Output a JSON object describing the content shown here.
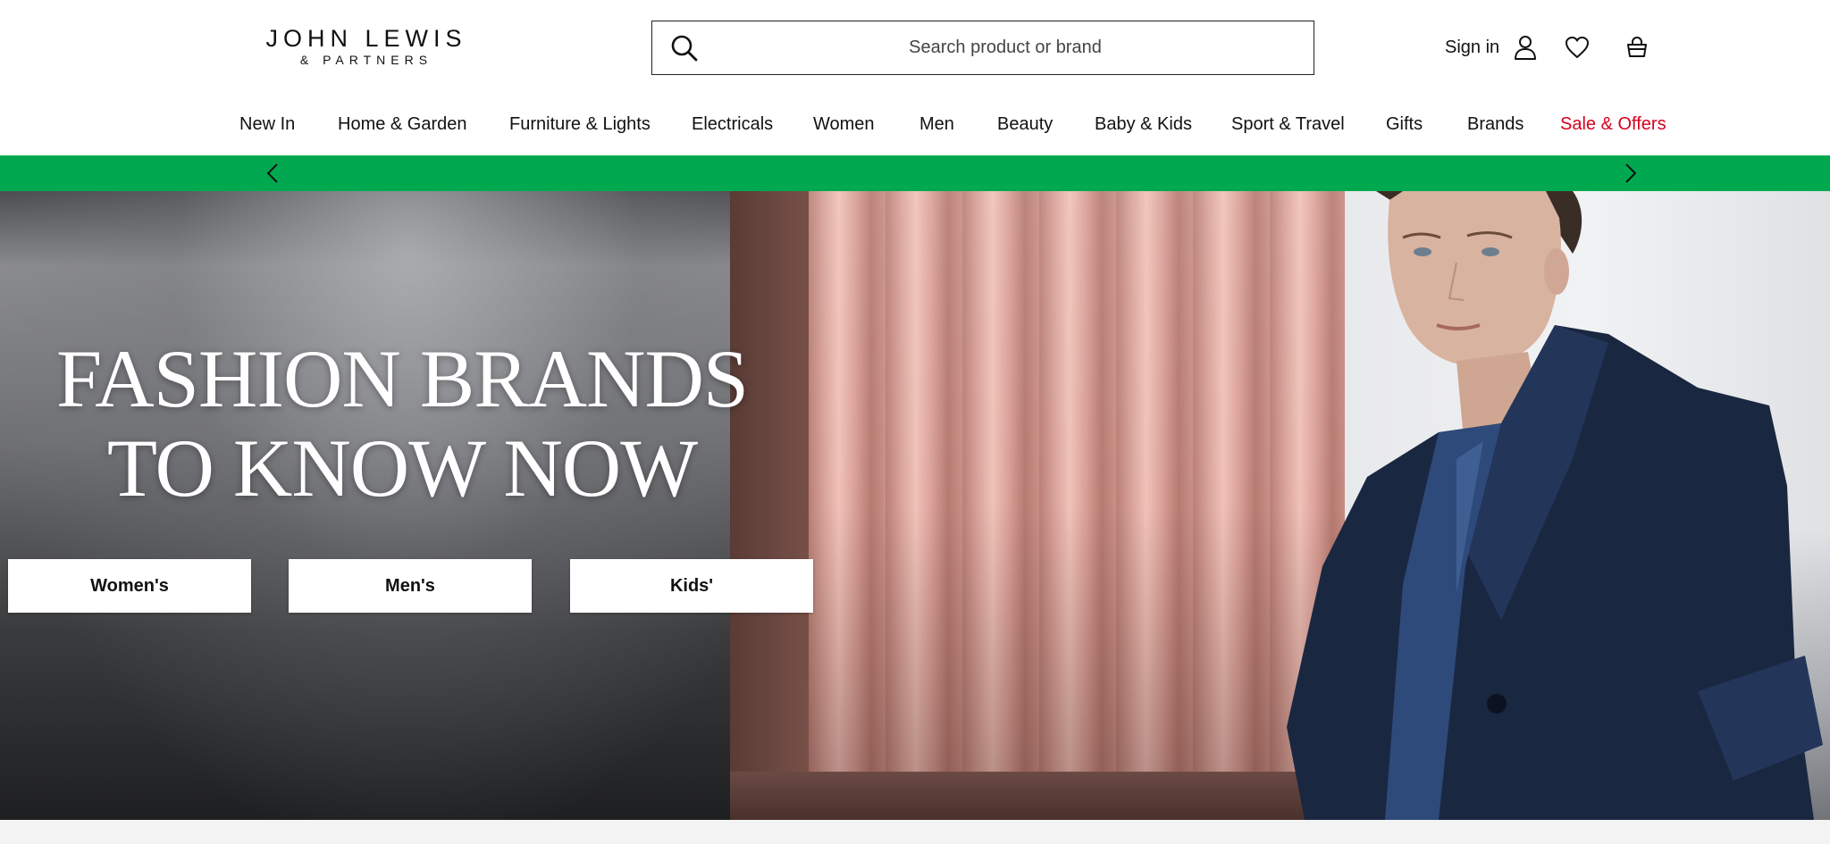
{
  "header": {
    "logo_main": "JOHN LEWIS",
    "logo_sub": "& PARTNERS",
    "search_placeholder": "Search product or brand",
    "sign_in_label": "Sign in"
  },
  "nav": {
    "items": [
      {
        "label": "New In"
      },
      {
        "label": "Home & Garden"
      },
      {
        "label": "Furniture & Lights"
      },
      {
        "label": "Electricals"
      },
      {
        "label": "Women"
      },
      {
        "label": "Men"
      },
      {
        "label": "Beauty"
      },
      {
        "label": "Baby & Kids"
      },
      {
        "label": "Sport & Travel"
      },
      {
        "label": "Gifts"
      },
      {
        "label": "Brands"
      },
      {
        "label": "Sale & Offers"
      }
    ]
  },
  "hero": {
    "title_line1": "FASHION BRANDS",
    "title_line2": "TO KNOW NOW",
    "buttons": [
      {
        "label": "Women's"
      },
      {
        "label": "Men's"
      },
      {
        "label": "Kids'"
      }
    ]
  },
  "colors": {
    "promo_strip": "#00a94f",
    "sale_link": "#d6001c",
    "text": "#111111"
  },
  "icons": {
    "search": "search-icon",
    "account": "user-icon",
    "wishlist": "heart-icon",
    "basket": "basket-icon",
    "promo_prev": "chevron-left-icon",
    "promo_next": "chevron-right-icon"
  }
}
